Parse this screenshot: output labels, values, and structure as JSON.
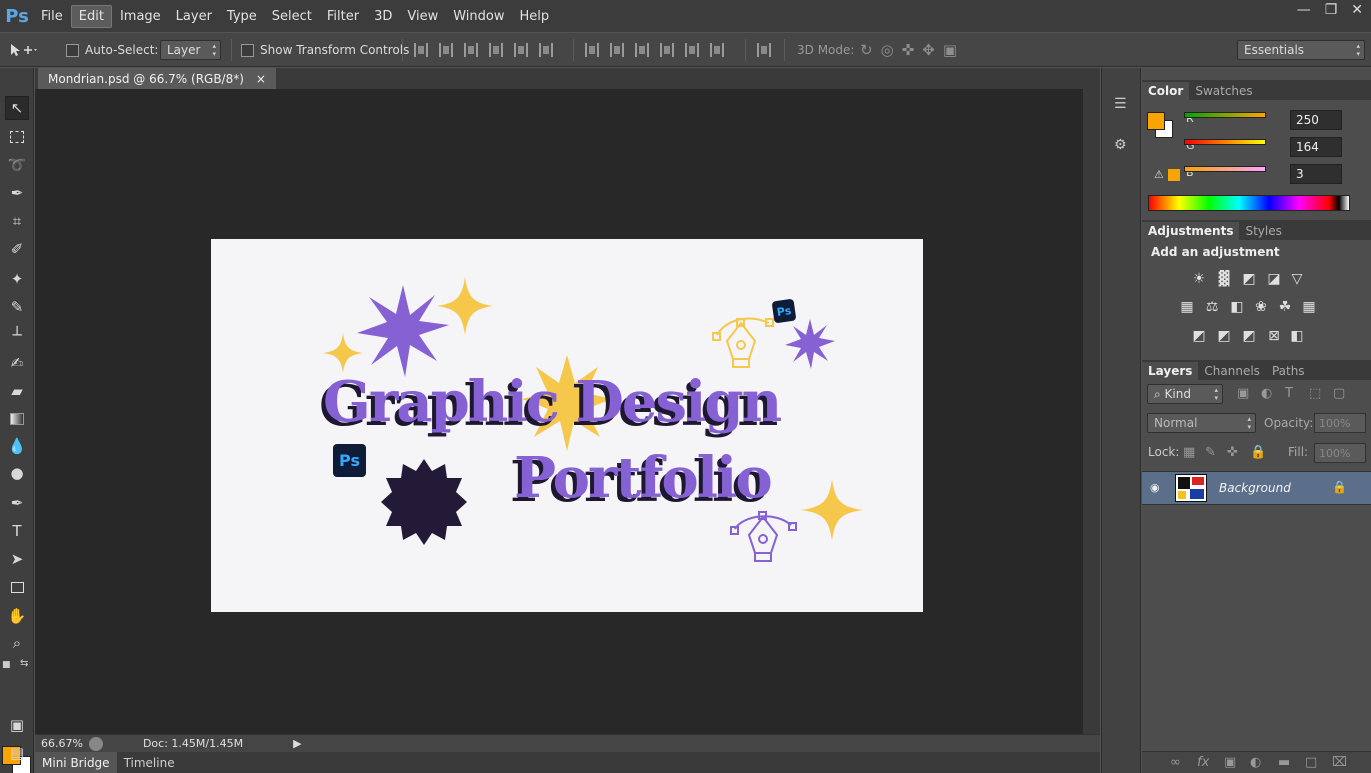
{
  "app": {
    "logo": "Ps"
  },
  "menu": [
    "File",
    "Edit",
    "Image",
    "Layer",
    "Type",
    "Select",
    "Filter",
    "3D",
    "View",
    "Window",
    "Help"
  ],
  "menu_active": "Edit",
  "window_controls": {
    "minimize": "—",
    "restore": "❐",
    "close": "✕"
  },
  "options": {
    "auto_select_label": "Auto-Select:",
    "auto_select_value": "Layer",
    "show_transform_label": "Show Transform Controls",
    "mode_3d_label": "3D Mode:",
    "workspace": "Essentials"
  },
  "document": {
    "tab_title": "Mondrian.psd @ 66.7% (RGB/8*)",
    "close_glyph": "×"
  },
  "artwork": {
    "line1": "Graphic Design",
    "line2": "Portfolio",
    "badge": "Ps",
    "colors": {
      "purple": "#8661d4",
      "yellow": "#f5c84b",
      "dark": "#231a38",
      "paper": "#f5f4f7"
    }
  },
  "status": {
    "zoom": "66.67%",
    "doc": "Doc: 1.45M/1.45M"
  },
  "bottom_tabs": [
    "Mini Bridge",
    "Timeline"
  ],
  "color_panel": {
    "tabs": [
      "Color",
      "Swatches"
    ],
    "fg_color": "#faa403",
    "r": {
      "label": "R",
      "value": "250"
    },
    "g": {
      "label": "G",
      "value": "164"
    },
    "b": {
      "label": "B",
      "value": "3"
    }
  },
  "adjustments_panel": {
    "tabs": [
      "Adjustments",
      "Styles"
    ],
    "title": "Add an adjustment"
  },
  "layers_panel": {
    "tabs": [
      "Layers",
      "Channels",
      "Paths"
    ],
    "kind_label": "⌕ Kind",
    "blend_mode": "Normal",
    "opacity_label": "Opacity:",
    "opacity_value": "100%",
    "lock_label": "Lock:",
    "fill_label": "Fill:",
    "fill_value": "100%",
    "layers": [
      {
        "name": "Background"
      }
    ]
  }
}
